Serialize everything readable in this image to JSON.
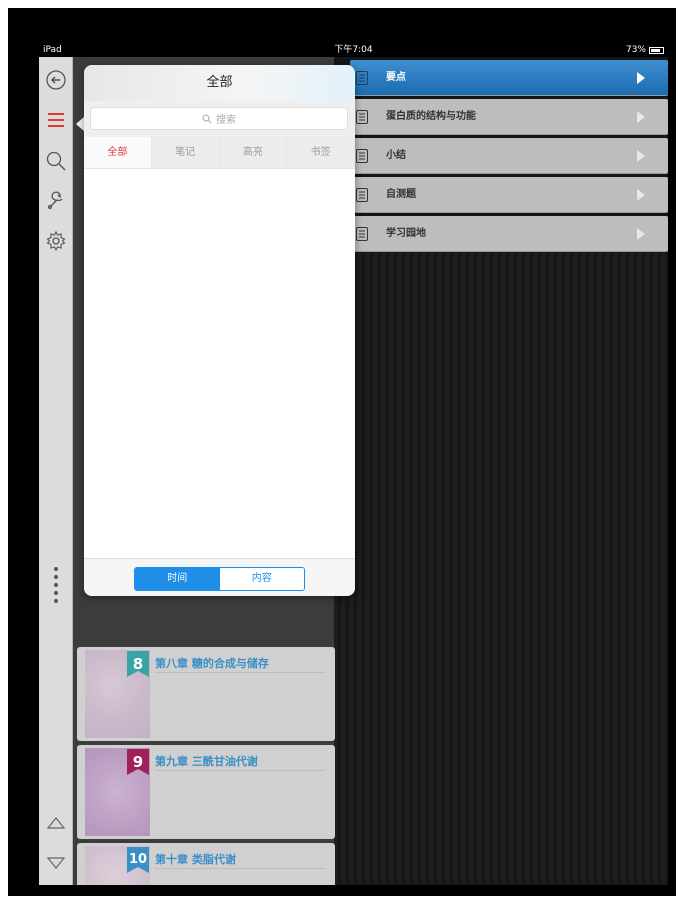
{
  "status_bar": {
    "device": "iPad",
    "time": "下午7:04",
    "battery": "73%"
  },
  "toolbar": {
    "icons": [
      "back-circle-icon",
      "menu-list-icon",
      "search-icon",
      "wrench-icon",
      "gear-icon",
      "drag-dots-icon",
      "triangle-up-icon",
      "triangle-down-icon"
    ],
    "accent": "#e43a3a"
  },
  "popover": {
    "title": "全部",
    "search_placeholder": "搜索",
    "tabs": [
      "全部",
      "笔记",
      "高亮",
      "书签"
    ],
    "active_tab": "全部",
    "segment": [
      "时间",
      "内容"
    ],
    "active_segment": "时间",
    "accent": "#1e8ee8"
  },
  "menu": {
    "items": [
      {
        "label": "要点",
        "active": true
      },
      {
        "label": "蛋白质的结构与功能",
        "active": false
      },
      {
        "label": "小结",
        "active": false
      },
      {
        "label": "自测题",
        "active": false
      },
      {
        "label": "学习园地",
        "active": false
      }
    ],
    "active_color": "#1b6cb0"
  },
  "chapters": [
    {
      "num": "8",
      "title": "第八章 糖的合成与储存",
      "badge_color": "#3aa3a3"
    },
    {
      "num": "9",
      "title": "第九章 三酰甘油代谢",
      "badge_color": "#a0205a"
    },
    {
      "num": "10",
      "title": "第十章 类脂代谢",
      "badge_color": "#3a8fc7"
    }
  ]
}
